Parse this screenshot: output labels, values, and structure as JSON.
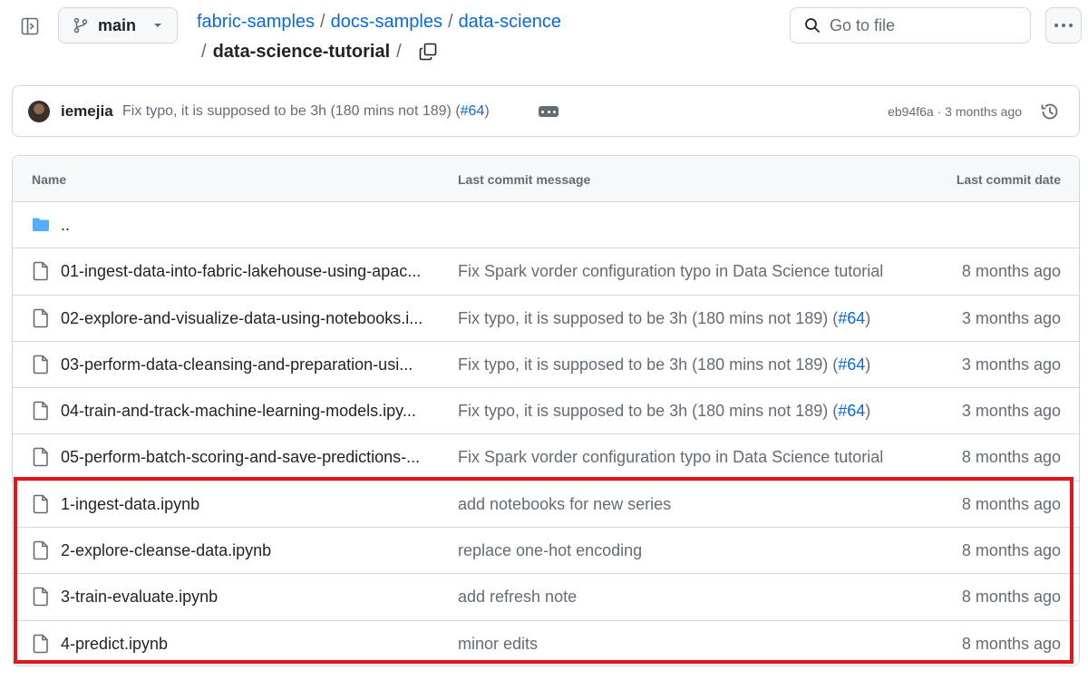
{
  "header": {
    "branch": "main",
    "breadcrumb_parts": [
      "fabric-samples",
      "docs-samples",
      "data-science"
    ],
    "current_folder": "data-science-tutorial",
    "search_placeholder": "Go to file"
  },
  "latest_commit": {
    "author": "iemejia",
    "message_prefix": "Fix typo, it is supposed to be 3h (180 mins not 189) (",
    "pr_link": "#64",
    "message_suffix": ")",
    "sha_time": "eb94f6a · 3 months ago"
  },
  "table": {
    "columns": [
      "Name",
      "Last commit message",
      "Last commit date"
    ],
    "parent_dir": "..",
    "rows": [
      {
        "name": "01-ingest-data-into-fabric-lakehouse-using-apac...",
        "msg": "Fix Spark vorder configuration typo in Data Science tutorial",
        "pr": "",
        "msg_suffix": "",
        "date": "8 months ago"
      },
      {
        "name": "02-explore-and-visualize-data-using-notebooks.i...",
        "msg": "Fix typo, it is supposed to be 3h (180 mins not 189) (",
        "pr": "#64",
        "msg_suffix": ")",
        "date": "3 months ago"
      },
      {
        "name": "03-perform-data-cleansing-and-preparation-usi...",
        "msg": "Fix typo, it is supposed to be 3h (180 mins not 189) (",
        "pr": "#64",
        "msg_suffix": ")",
        "date": "3 months ago"
      },
      {
        "name": "04-train-and-track-machine-learning-models.ipy...",
        "msg": "Fix typo, it is supposed to be 3h (180 mins not 189) (",
        "pr": "#64",
        "msg_suffix": ")",
        "date": "3 months ago"
      },
      {
        "name": "05-perform-batch-scoring-and-save-predictions-...",
        "msg": "Fix Spark vorder configuration typo in Data Science tutorial",
        "pr": "",
        "msg_suffix": "",
        "date": "8 months ago"
      },
      {
        "name": "1-ingest-data.ipynb",
        "msg": "add notebooks for new series",
        "pr": "",
        "msg_suffix": "",
        "date": "8 months ago"
      },
      {
        "name": "2-explore-cleanse-data.ipynb",
        "msg": "replace one-hot encoding",
        "pr": "",
        "msg_suffix": "",
        "date": "8 months ago"
      },
      {
        "name": "3-train-evaluate.ipynb",
        "msg": "add refresh note",
        "pr": "",
        "msg_suffix": "",
        "date": "8 months ago"
      },
      {
        "name": "4-predict.ipynb",
        "msg": "minor edits",
        "pr": "",
        "msg_suffix": "",
        "date": "8 months ago"
      }
    ]
  },
  "colors": {
    "link": "#0969da",
    "folder": "#54aeff",
    "muted": "#636c76",
    "highlight": "#e3161b"
  },
  "icons": {
    "sidebar_toggle": "sidebar-expand-icon",
    "branch": "git-branch-icon",
    "copy": "copy-icon",
    "search": "search-icon",
    "more": "kebab-horizontal-icon",
    "history": "history-icon",
    "folder": "folder-icon",
    "file": "file-icon"
  }
}
